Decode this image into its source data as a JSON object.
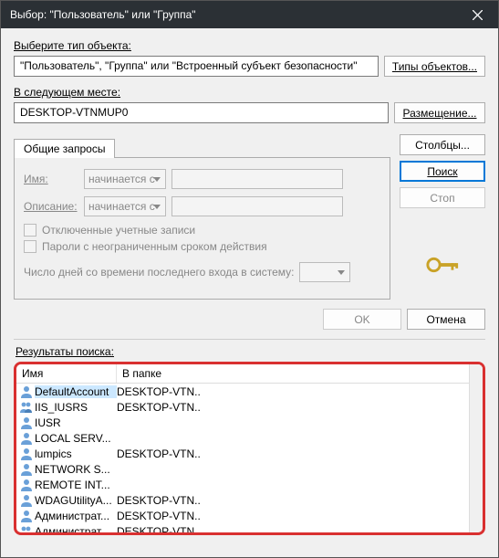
{
  "window": {
    "title": "Выбор: \"Пользователь\" или \"Группа\""
  },
  "objectType": {
    "label": "Выберите тип объекта:",
    "value": "\"Пользователь\", \"Группа\" или \"Встроенный субъект безопасности\"",
    "button": "Типы объектов..."
  },
  "location": {
    "label": "В следующем месте:",
    "value": "DESKTOP-VTNMUP0",
    "button": "Размещение..."
  },
  "tabs": {
    "common": "Общие запросы"
  },
  "filters": {
    "nameLabel": "Имя:",
    "descLabel": "Описание:",
    "startsWith": "начинается с",
    "disabledAccounts": "Отключенные учетные записи",
    "nonExpiring": "Пароли с неограниченным сроком действия",
    "daysSince": "Число дней со времени последнего входа в систему:"
  },
  "sideButtons": {
    "columns": "Столбцы...",
    "search": "Поиск",
    "stop": "Стоп"
  },
  "dialogButtons": {
    "ok": "OK",
    "cancel": "Отмена"
  },
  "results": {
    "label": "Результаты поиска:",
    "colName": "Имя",
    "colFolder": "В папке",
    "rows": [
      {
        "icon": "user",
        "name": "DefaultAccount",
        "folder": "DESKTOP-VTN..",
        "selected": true
      },
      {
        "icon": "group",
        "name": "IIS_IUSRS",
        "folder": "DESKTOP-VTN..",
        "selected": false
      },
      {
        "icon": "user",
        "name": "IUSR",
        "folder": "",
        "selected": false
      },
      {
        "icon": "user",
        "name": "LOCAL SERV...",
        "folder": "",
        "selected": false
      },
      {
        "icon": "user",
        "name": "lumpics",
        "folder": "DESKTOP-VTN..",
        "selected": false
      },
      {
        "icon": "user",
        "name": "NETWORK S...",
        "folder": "",
        "selected": false
      },
      {
        "icon": "user",
        "name": "REMOTE INT...",
        "folder": "",
        "selected": false
      },
      {
        "icon": "user",
        "name": "WDAGUtilityA...",
        "folder": "DESKTOP-VTN..",
        "selected": false
      },
      {
        "icon": "user",
        "name": "Администрат...",
        "folder": "DESKTOP-VTN..",
        "selected": false
      },
      {
        "icon": "group",
        "name": "Администрат...",
        "folder": "DESKTOP-VTN..",
        "selected": false
      }
    ]
  }
}
